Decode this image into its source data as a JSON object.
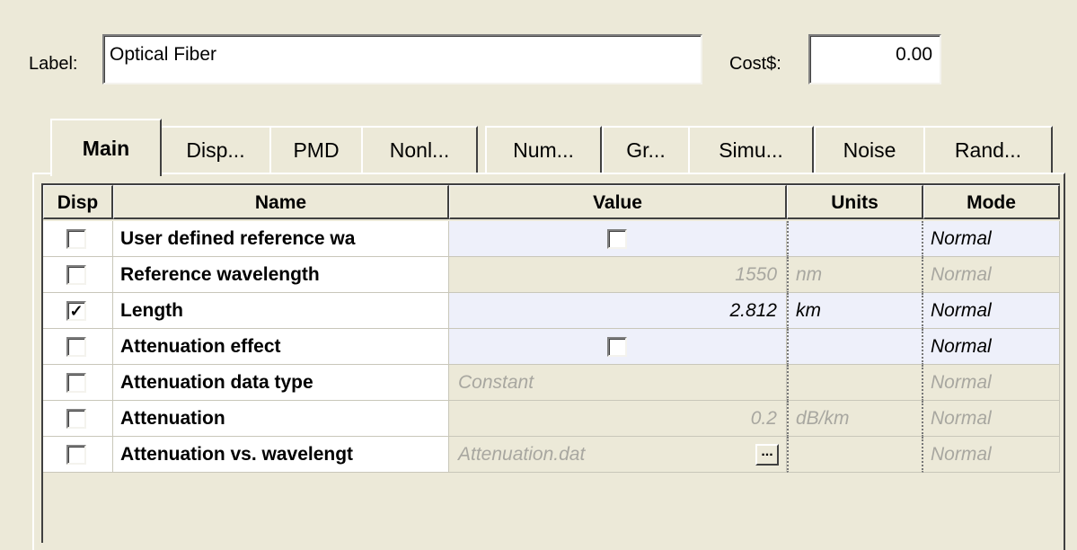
{
  "form": {
    "label_caption": "Label:",
    "label_value": "Optical Fiber",
    "cost_caption": "Cost$:",
    "cost_value": "0.00"
  },
  "tabs": [
    {
      "label": "Main",
      "active": true
    },
    {
      "label": "Disp..."
    },
    {
      "label": "PMD"
    },
    {
      "label": "Nonl..."
    },
    {
      "label": "Num..."
    },
    {
      "label": "Gr..."
    },
    {
      "label": "Simu..."
    },
    {
      "label": "Noise"
    },
    {
      "label": "Rand..."
    }
  ],
  "grid": {
    "headers": {
      "disp": "Disp",
      "name": "Name",
      "value": "Value",
      "units": "Units",
      "mode": "Mode"
    },
    "rows": [
      {
        "disp_checked": false,
        "name": "User defined reference wa",
        "value": "",
        "value_type": "checkbox",
        "value_checked": false,
        "units": "",
        "mode": "Normal",
        "editable": true
      },
      {
        "disp_checked": false,
        "name": "Reference wavelength",
        "value": "1550",
        "value_type": "number",
        "units": "nm",
        "mode": "Normal",
        "editable": false
      },
      {
        "disp_checked": true,
        "name": "Length",
        "value": "2.812",
        "value_type": "number",
        "units": "km",
        "mode": "Normal",
        "editable": true
      },
      {
        "disp_checked": false,
        "name": "Attenuation effect",
        "value": "",
        "value_type": "checkbox",
        "value_checked": false,
        "units": "",
        "mode": "Normal",
        "editable": true
      },
      {
        "disp_checked": false,
        "name": "Attenuation data type",
        "value": "Constant",
        "value_type": "text",
        "units": "",
        "mode": "Normal",
        "editable": false
      },
      {
        "disp_checked": false,
        "name": "Attenuation",
        "value": "0.2",
        "value_type": "number",
        "units": "dB/km",
        "mode": "Normal",
        "editable": false
      },
      {
        "disp_checked": false,
        "name": "Attenuation vs. wavelengt",
        "value": "Attenuation.dat",
        "value_type": "file",
        "browse_label": "...",
        "units": "",
        "mode": "Normal",
        "editable": false
      }
    ]
  },
  "colors": {
    "dialog_bg": "#ece9d8",
    "editable_cell_bg": "#eef0fa",
    "disabled_text": "#a8a7a0"
  }
}
